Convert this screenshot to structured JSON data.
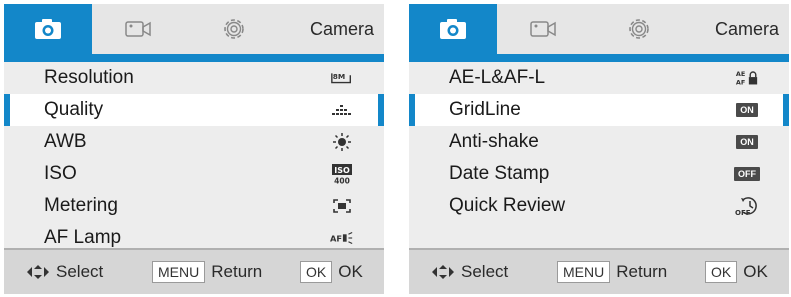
{
  "colors": {
    "accent": "#1387c9",
    "panel_bg": "#ededed",
    "footer_bg": "#d6d6d6"
  },
  "panels": [
    {
      "tab_title": "Camera",
      "tabs": [
        {
          "icon": "camera-icon",
          "active": true
        },
        {
          "icon": "video-icon",
          "active": false
        },
        {
          "icon": "settings-gear-icon",
          "active": false
        }
      ],
      "rows": [
        {
          "label": "Resolution",
          "icon": "resolution-8m-icon",
          "icon_text": "8M",
          "selected": false
        },
        {
          "label": "Quality",
          "icon": "quality-dots-icon",
          "selected": true
        },
        {
          "label": "AWB",
          "icon": "awb-sun-icon",
          "selected": false
        },
        {
          "label": "ISO",
          "icon": "iso-400-icon",
          "icon_text": "ISO 400",
          "selected": false
        },
        {
          "label": "Metering",
          "icon": "metering-icon",
          "selected": false
        },
        {
          "label": "AF Lamp",
          "icon": "af-lamp-icon",
          "icon_text": "AF",
          "selected": false
        }
      ],
      "footer": {
        "select_label": "Select",
        "menu_key": "MENU",
        "menu_label": "Return",
        "ok_key": "OK",
        "ok_label": "OK"
      }
    },
    {
      "tab_title": "Camera",
      "tabs": [
        {
          "icon": "camera-icon",
          "active": true
        },
        {
          "icon": "video-icon",
          "active": false
        },
        {
          "icon": "settings-gear-icon",
          "active": false
        }
      ],
      "rows": [
        {
          "label": "AE-L&AF-L",
          "icon": "ae-af-lock-icon",
          "icon_text": "AE AF",
          "selected": false
        },
        {
          "label": "GridLine",
          "icon": "on-badge-icon",
          "value": "ON",
          "selected": true
        },
        {
          "label": "Anti-shake",
          "icon": "on-badge-icon",
          "value": "ON",
          "selected": false
        },
        {
          "label": "Date Stamp",
          "icon": "off-badge-icon",
          "value": "OFF",
          "selected": false
        },
        {
          "label": "Quick Review",
          "icon": "quick-review-off-icon",
          "icon_text": "OFF",
          "selected": false
        }
      ],
      "footer": {
        "select_label": "Select",
        "menu_key": "MENU",
        "menu_label": "Return",
        "ok_key": "OK",
        "ok_label": "OK"
      }
    }
  ]
}
